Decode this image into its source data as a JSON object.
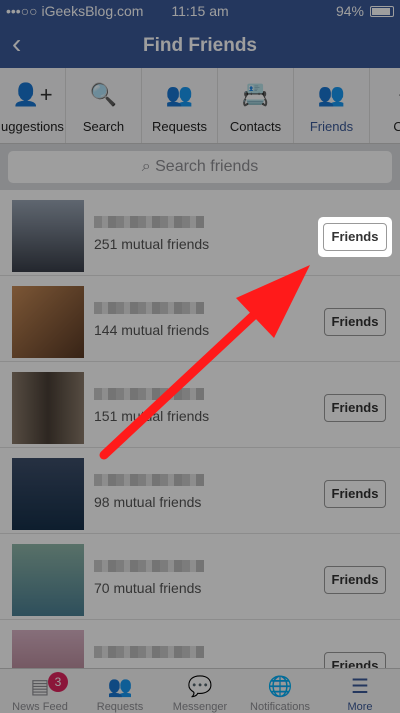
{
  "status": {
    "carrier": "•••○○ iGeeksBlog.com",
    "time": "11:15 am",
    "battery": "94%"
  },
  "header": {
    "title": "Find Friends",
    "back_icon": "chevron-left-icon"
  },
  "tabs": [
    {
      "label": "uggestions",
      "icon": "add-person-icon"
    },
    {
      "label": "Search",
      "icon": "search-icon"
    },
    {
      "label": "Requests",
      "icon": "people-icon"
    },
    {
      "label": "Contacts",
      "icon": "address-book-icon"
    },
    {
      "label": "Friends",
      "icon": "friends-icon",
      "active": true
    },
    {
      "label": "Outg",
      "icon": "outgoing-icon"
    }
  ],
  "search": {
    "placeholder": "Search friends"
  },
  "friends": [
    {
      "mutual": "251 mutual friends",
      "button": "Friends"
    },
    {
      "mutual": "144 mutual friends",
      "button": "Friends"
    },
    {
      "mutual": "151 mutual friends",
      "button": "Friends"
    },
    {
      "mutual": "98 mutual friends",
      "button": "Friends"
    },
    {
      "mutual": "70 mutual friends",
      "button": "Friends"
    },
    {
      "mutual": "",
      "button": "Friends"
    }
  ],
  "tabbar": [
    {
      "label": "News Feed",
      "icon": "news-feed-icon",
      "badge": "3"
    },
    {
      "label": "Requests",
      "icon": "requests-icon"
    },
    {
      "label": "Messenger",
      "icon": "messenger-icon"
    },
    {
      "label": "Notifications",
      "icon": "globe-icon"
    },
    {
      "label": "More",
      "icon": "menu-icon",
      "active": true
    }
  ],
  "colors": {
    "brand": "#3b5998",
    "annotation_arrow": "#ff1a1a",
    "badge": "#e0245e"
  }
}
